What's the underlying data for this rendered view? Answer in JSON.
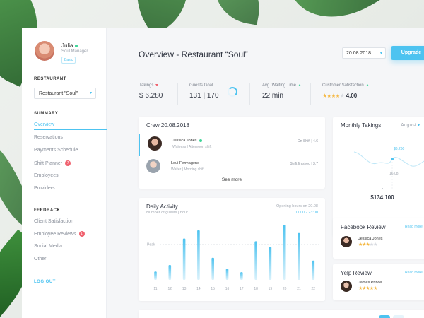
{
  "user": {
    "name": "Julia",
    "role": "Soul Manager",
    "badge": "Basic"
  },
  "sidebar": {
    "restaurant_heading": "RESTAURANT",
    "restaurant_select": "Restaurant \"Soul\"",
    "summary_heading": "SUMMARY",
    "summary_items": [
      {
        "label": "Overview"
      },
      {
        "label": "Reservations"
      },
      {
        "label": "Payments Schedule"
      },
      {
        "label": "Shift Planner",
        "badge": "7"
      },
      {
        "label": "Employees"
      },
      {
        "label": "Providers"
      }
    ],
    "feedback_heading": "FEEDBACK",
    "feedback_items": [
      {
        "label": "Client Satisfaction"
      },
      {
        "label": "Employee Reviews",
        "badge": "1"
      },
      {
        "label": "Social Media"
      },
      {
        "label": "Other"
      }
    ],
    "logout": "LOG OUT"
  },
  "header": {
    "title": "Overview - Restaurant “Soul”",
    "date": "20.08.2018",
    "upgrade": "Upgrade"
  },
  "kpis": [
    {
      "label": "Takings",
      "value": "$ 6.280",
      "trend": "down"
    },
    {
      "label": "Guests Goal",
      "value": "131 | 170",
      "progress": 0.77
    },
    {
      "label": "Avg. Waiting Time",
      "value": "22 min",
      "trend": "up"
    },
    {
      "label": "Customer Satisfaction",
      "value": "4.00",
      "trend": "up",
      "stars": 4
    }
  ],
  "crew": {
    "title": "Crew 20.08.2018",
    "rows": [
      {
        "name": "Jessica Jones",
        "sub": "Waitress  |  Afternoon shift",
        "status": "On Shift  |  4.6"
      },
      {
        "name": "Loui Fermagene",
        "sub": "Waiter  |  Morning shift",
        "status": "Shift finished  |  3.7"
      }
    ],
    "see_more": "See more"
  },
  "monthly": {
    "title": "Monthly Takings",
    "month": "August",
    "peak_value": "$6.260",
    "peak_date": "16.08",
    "total": "$134.100"
  },
  "chart_data": {
    "type": "bar",
    "title": "Daily Activity",
    "subtitle": "Number of guests | hour",
    "note_label": "Opening hours on 20.08",
    "note_value": "11:00 - 23:00",
    "peak_label": "Peak",
    "categories": [
      "11",
      "12",
      "13",
      "14",
      "15",
      "16",
      "17",
      "18",
      "19",
      "20",
      "21",
      "22"
    ],
    "values": [
      0.15,
      0.27,
      0.75,
      0.9,
      0.4,
      0.2,
      0.14,
      0.7,
      0.6,
      1.0,
      0.85,
      0.35
    ]
  },
  "facebook": {
    "title": "Facebook Review",
    "link": "Read more",
    "name": "Jessica Jones",
    "stars": 3
  },
  "yelp": {
    "title": "Yelp Review",
    "link": "Read more",
    "name": "James Prince",
    "stars": 5
  }
}
